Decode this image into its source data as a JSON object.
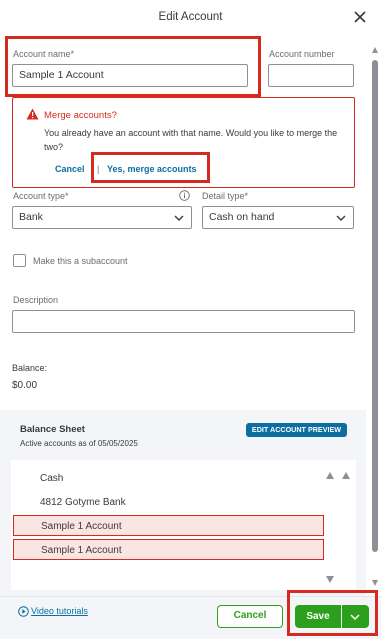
{
  "header": {
    "title": "Edit Account",
    "close_icon": "close-icon"
  },
  "form": {
    "account_name_label": "Account name*",
    "account_name_value": "Sample 1 Account",
    "account_number_label": "Account number",
    "account_number_value": "",
    "account_type_label": "Account type*",
    "account_type_value": "Bank",
    "detail_type_label": "Detail type*",
    "detail_type_value": "Cash on hand",
    "subaccount_label": "Make this a subaccount",
    "subaccount_checked": false,
    "description_label": "Description",
    "description_value": "",
    "balance_label": "Balance:",
    "balance_value": "$0.00"
  },
  "merge": {
    "title": "Merge accounts?",
    "message": "You already have an account with that name. Would you like to merge the two?",
    "cancel_label": "Cancel",
    "separator": "|",
    "confirm_label": "Yes, merge accounts",
    "color": "#d52b1e"
  },
  "balance_sheet": {
    "title": "Balance Sheet",
    "subtitle": "Active accounts as of 05/05/2025",
    "preview_button": "EDIT ACCOUNT PREVIEW",
    "accounts": [
      "Cash",
      "4812 Gotyme Bank",
      "Sample 1 Account",
      "Sample 1 Account"
    ]
  },
  "footer": {
    "video_link": "Video tutorials",
    "cancel_label": "Cancel",
    "save_label": "Save"
  },
  "colors": {
    "accent_green": "#2ca01c",
    "link_blue": "#0d6fa1",
    "alert_red": "#d52b1e",
    "text": "#393a3d"
  }
}
